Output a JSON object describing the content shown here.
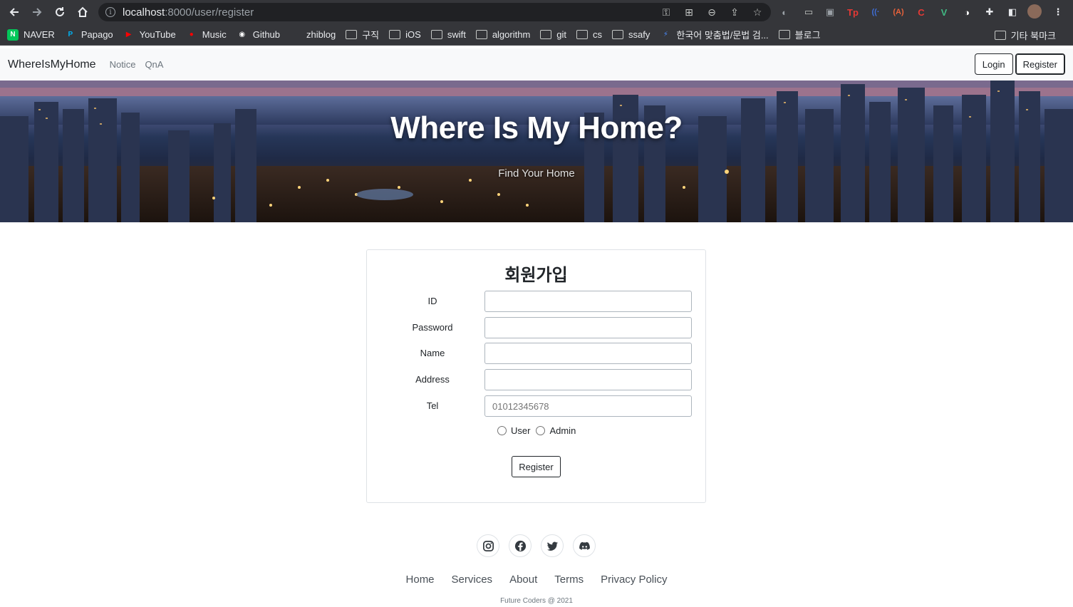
{
  "browser": {
    "url_host": "localhost",
    "url_path": ":8000/user/register",
    "bookmarks": [
      {
        "label": "NAVER",
        "type": "site",
        "color": "#03c75a",
        "glyph": "N"
      },
      {
        "label": "Papago",
        "type": "site",
        "color": "#00b0f0",
        "glyph": "P"
      },
      {
        "label": "YouTube",
        "type": "site",
        "color": "#ff0000",
        "glyph": "▶"
      },
      {
        "label": "Music",
        "type": "site",
        "color": "#ff0000",
        "glyph": "●"
      },
      {
        "label": "Github",
        "type": "site",
        "color": "#ffffff",
        "glyph": "◉"
      },
      {
        "label": "zhiblog",
        "type": "site",
        "color": "#35363a",
        "glyph": "⁘"
      },
      {
        "label": "구직",
        "type": "folder"
      },
      {
        "label": "iOS",
        "type": "folder"
      },
      {
        "label": "swift",
        "type": "folder"
      },
      {
        "label": "algorithm",
        "type": "folder"
      },
      {
        "label": "git",
        "type": "folder"
      },
      {
        "label": "cs",
        "type": "folder"
      },
      {
        "label": "ssafy",
        "type": "folder"
      },
      {
        "label": "한국어 맞춤법/문법 검...",
        "type": "site",
        "color": "#4a8cff",
        "glyph": "⚡"
      },
      {
        "label": "블로그",
        "type": "folder"
      }
    ],
    "other_bookmarks": "기타 북마크"
  },
  "navbar": {
    "brand": "WhereIsMyHome",
    "links": [
      "Notice",
      "QnA"
    ],
    "login_label": "Login",
    "register_label": "Register"
  },
  "hero": {
    "title": "Where Is My Home?",
    "subtitle": "Find Your Home"
  },
  "form": {
    "title": "회원가입",
    "fields": [
      {
        "label": "ID",
        "value": "",
        "placeholder": ""
      },
      {
        "label": "Password",
        "value": "",
        "placeholder": ""
      },
      {
        "label": "Name",
        "value": "",
        "placeholder": ""
      },
      {
        "label": "Address",
        "value": "",
        "placeholder": ""
      },
      {
        "label": "Tel",
        "value": "",
        "placeholder": "01012345678"
      }
    ],
    "role_options": [
      "User",
      "Admin"
    ],
    "submit_label": "Register"
  },
  "footer": {
    "social": [
      "instagram-icon",
      "facebook-icon",
      "twitter-icon",
      "discord-icon"
    ],
    "links": [
      "Home",
      "Services",
      "About",
      "Terms",
      "Privacy Policy"
    ],
    "copyright": "Future Coders @ 2021"
  }
}
